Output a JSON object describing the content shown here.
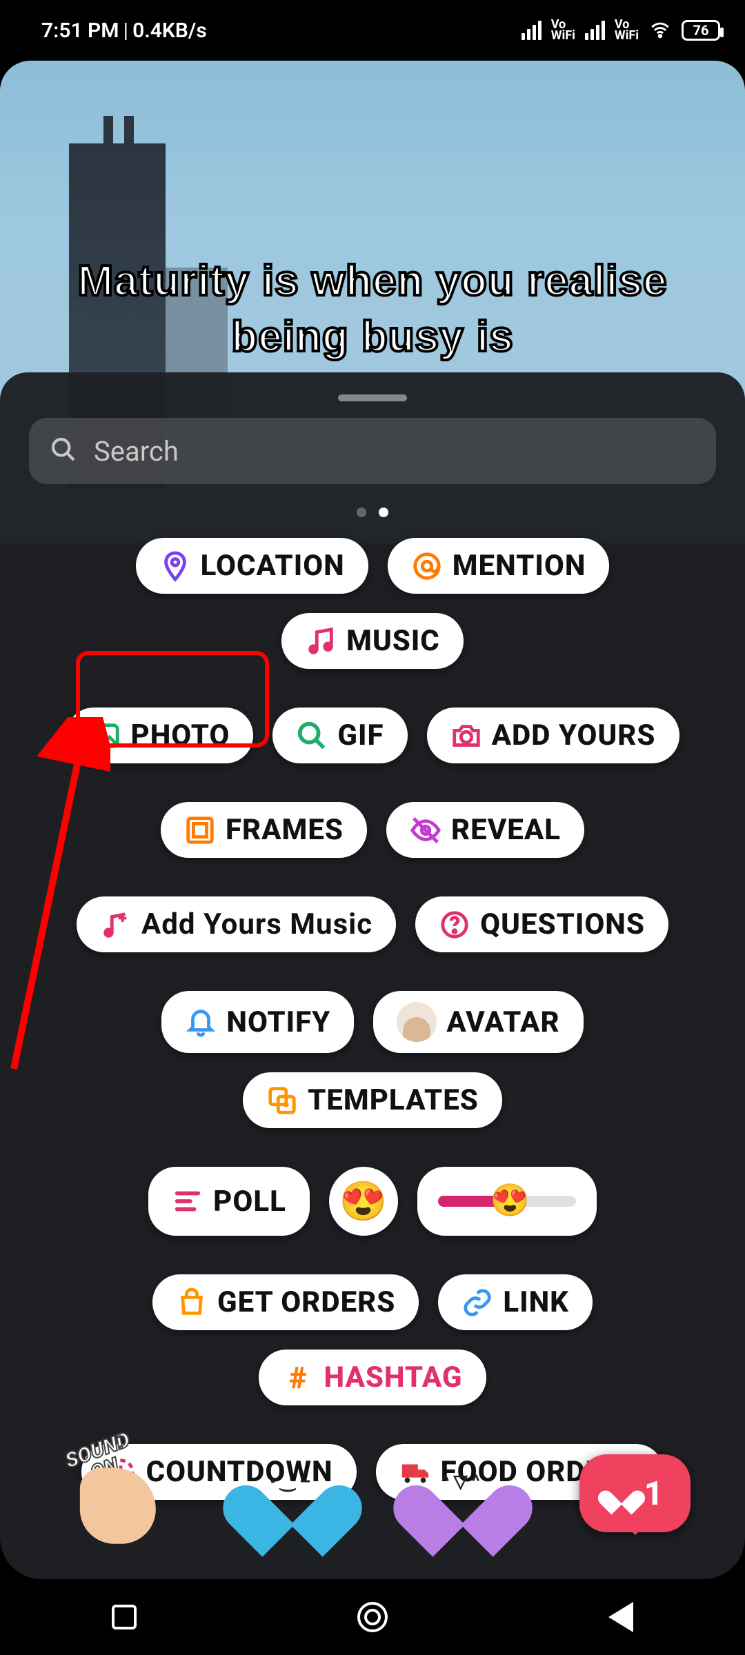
{
  "status": {
    "time": "7:51 PM",
    "net_speed": "0.4KB/s",
    "vowifi": "Vo\nWiFi",
    "battery": "76"
  },
  "story": {
    "text": "Maturity is when you realise being busy is"
  },
  "search": {
    "placeholder": "Search"
  },
  "stickers": {
    "location": "LOCATION",
    "mention": "MENTION",
    "music": "MUSIC",
    "photo": "PHOTO",
    "gif": "GIF",
    "add_yours": "ADD YOURS",
    "frames": "FRAMES",
    "reveal": "REVEAL",
    "add_yours_music": "Add Yours Music",
    "questions": "QUESTIONS",
    "notify": "NOTIFY",
    "avatar": "AVATAR",
    "templates": "TEMPLATES",
    "poll": "POLL",
    "get_orders": "GET ORDERS",
    "link": "LINK",
    "hashtag": "HASHTAG",
    "countdown": "COUNTDOWN",
    "food_orders": "FOOD ORDERS"
  },
  "bottom": {
    "sound_on": "SOUND\nON",
    "like_count": "1"
  },
  "colors": {
    "location": "#7b3ff2",
    "mention": "#ff7a00",
    "music": "#e1306c",
    "photo": "#1fae6a",
    "gif": "#1fae6a",
    "add_yours": "#e1306c",
    "frames": "#ff7a00",
    "reveal": "#c837d6",
    "add_yours_music": "#e1306c",
    "questions": "#e1306c",
    "notify": "#3897f0",
    "templates": "#ff9500",
    "poll": "#e1306c",
    "get_orders": "#ff9500",
    "link": "#3897f0",
    "hashtag": "#ff7a00",
    "hashtag_text": "#e1306c",
    "countdown": "#e1306c",
    "food_orders": "#e63946"
  },
  "annotation": {
    "highlight_target": "photo"
  }
}
